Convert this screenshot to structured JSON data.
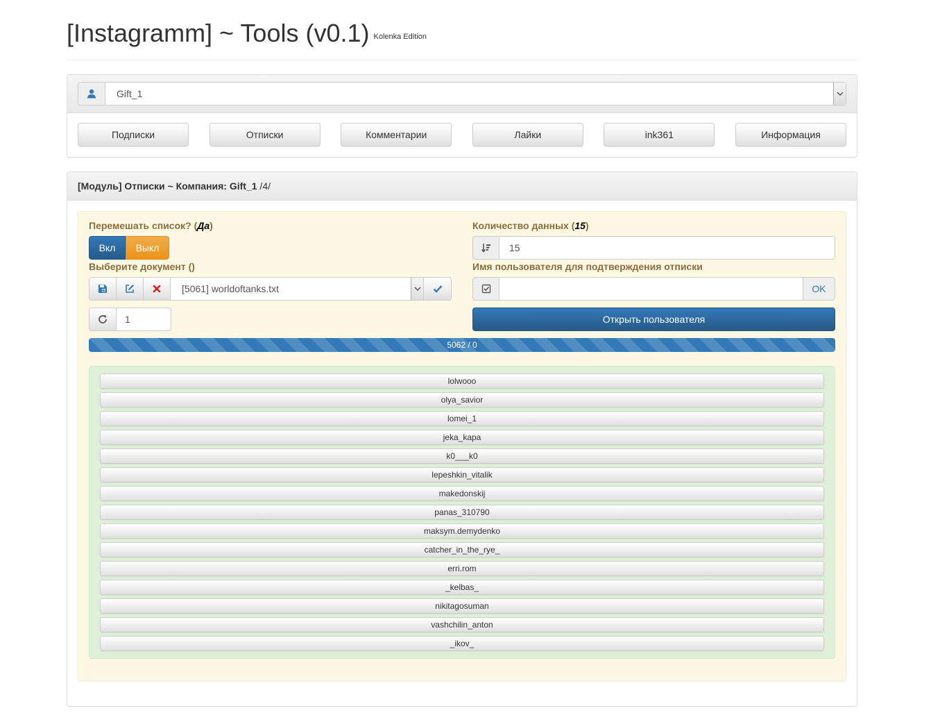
{
  "header": {
    "title": "[Instagramm] ~ Tools (v0.1)",
    "subtitle": "Kolenka Edition"
  },
  "account": {
    "selected": "Gift_1",
    "icon": "user-icon"
  },
  "nav": {
    "buttons": [
      "Подписки",
      "Отписки",
      "Комментарии",
      "Лайки",
      "ink361",
      "Информация"
    ]
  },
  "module": {
    "title_bold": "[Модуль] Отписки ~ Компания: Gift_1",
    "title_rest": " /4/"
  },
  "shuffle": {
    "label": "Перемешать список? (",
    "value": "Да",
    "label_end": ")",
    "on_label": "Вкл",
    "off_label": "Выкл"
  },
  "quantity": {
    "label": "Количество данных (",
    "value": "15",
    "label_end": ")",
    "input_value": "15",
    "icon": "sort-amount-icon"
  },
  "document": {
    "label": "Выберите документ ()",
    "selected": "[5061] worldoftanks.txt",
    "icons": [
      "save-icon",
      "edit-icon",
      "remove-icon",
      "check-icon"
    ]
  },
  "confirm_user": {
    "label": "Имя пользователя для подтверждения отписки",
    "value": "",
    "ok_label": "OK",
    "icon": "checkbox-icon"
  },
  "counter": {
    "value": "1",
    "icon": "refresh-icon"
  },
  "open_user": {
    "label": "Открыть пользователя"
  },
  "progress": {
    "label": "5062 / 0",
    "fraction": 1.0
  },
  "users": [
    "lolwooo",
    "olya_savior",
    "lomei_1",
    "jeka_kapa",
    "k0___k0",
    "lepeshkin_vitalik",
    "makedonskij",
    "panas_310790",
    "maksym.demydenko",
    "catcher_in_the_rye_",
    "erri.rom",
    "_kelbas_",
    "nikitagosuman",
    "vashchilin_anton",
    "_ikov_"
  ],
  "colors": {
    "primary": "#337ab7",
    "warning": "#f0ad4e",
    "label_brown": "#8a6d3b",
    "yellow_bg": "#fcf8e3",
    "green_bg": "#dff0d8",
    "danger": "#e31b1b"
  }
}
